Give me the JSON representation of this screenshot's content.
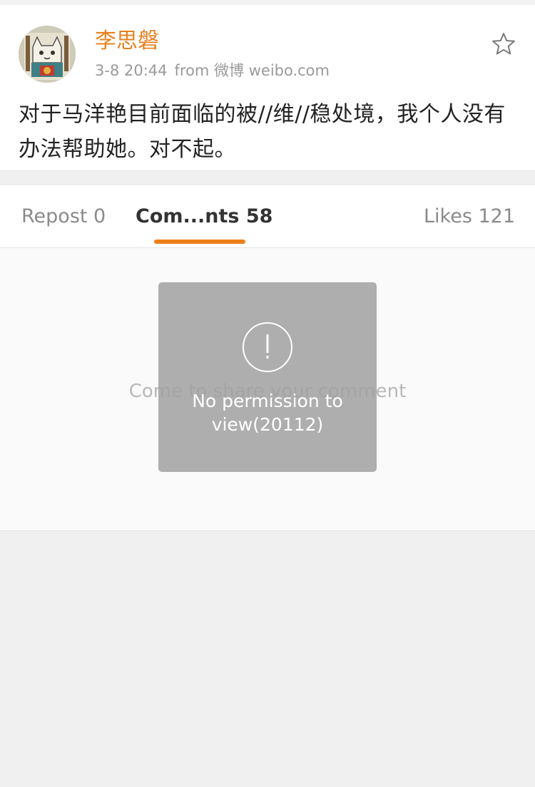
{
  "post": {
    "username": "李思磐",
    "timestamp": "3-8 20:44",
    "source": "from 微博 weibo.com",
    "text": "对于马洋艳目前面临的被//维//稳处境，我个人没有办法帮助她。对不起。",
    "favorite_icon": "star-outline-icon"
  },
  "tabs": {
    "repost": "Repost 0",
    "comments": "Com...nts 58",
    "likes": "Likes 121",
    "active": "comments"
  },
  "comments": {
    "empty_text": "Come to share your comment"
  },
  "toast": {
    "icon": "exclamation-circle-icon",
    "message": "No permission to view(20112)"
  },
  "colors": {
    "accent": "#ee7f16",
    "username": "#e8801e",
    "toast_bg": "#a0a0a0"
  }
}
